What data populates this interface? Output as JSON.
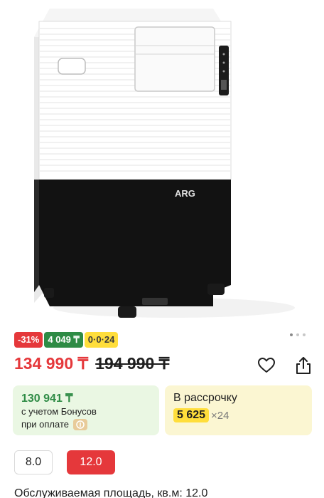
{
  "product": {
    "brand_logo": "ARG",
    "image_name": "portable-air-conditioner"
  },
  "gallery": {
    "dots_count": 3,
    "active_index": 0
  },
  "badges": {
    "discount": "-31%",
    "bonus": "4 049 ₸",
    "installment": "0·0·24"
  },
  "price": {
    "current": "134 990 ₸",
    "old": "194 990 ₸"
  },
  "actions": {
    "favorite_icon": "heart-icon",
    "share_icon": "share-icon"
  },
  "bonus_card": {
    "price": "130 941 ₸",
    "line1": "с учетом Бонусов",
    "line2": "при оплате",
    "icon": "kaspi-coin-icon"
  },
  "credit_card": {
    "title": "В рассрочку",
    "amount": "5 625",
    "term": "×24"
  },
  "options": [
    {
      "label": "8.0",
      "selected": false
    },
    {
      "label": "12.0",
      "selected": true
    }
  ],
  "spec_label": "Обслуживаемая площадь, кв.м: 12.0",
  "colors": {
    "accent_red": "#e5383b",
    "bonus_green": "#2e8b45",
    "installment_yellow": "#ffde3b",
    "bonus_card_bg": "#eaf7e3",
    "credit_card_bg": "#fbf6d2"
  }
}
